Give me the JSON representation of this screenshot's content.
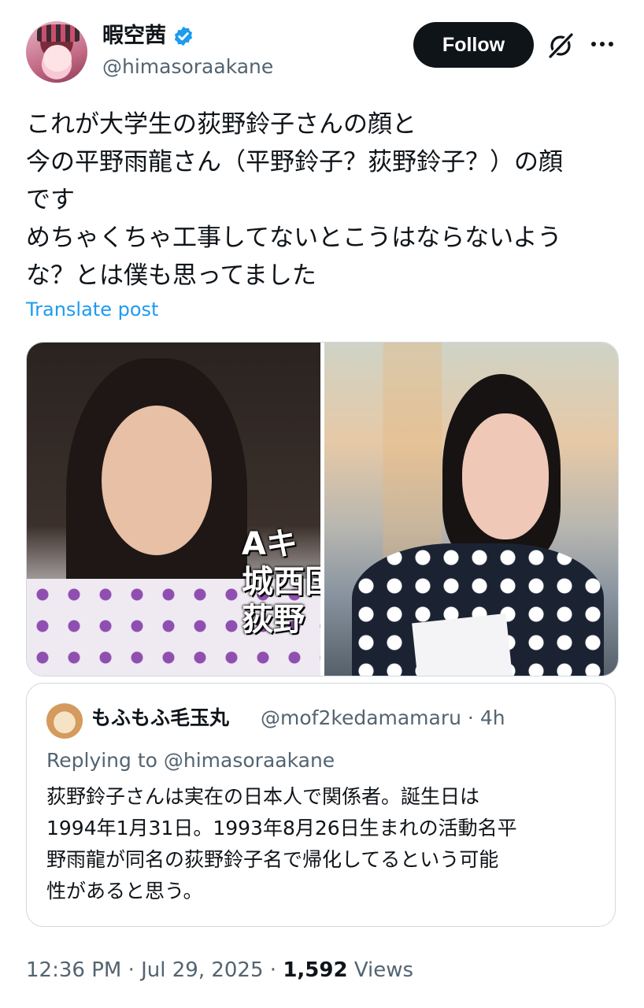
{
  "author": {
    "display_name": "暇空茜",
    "handle": "@himasoraakane",
    "verified_icon": "verified-badge-icon"
  },
  "actions": {
    "follow_label": "Follow",
    "grok_icon": "grok-icon",
    "more_icon": "more-icon"
  },
  "post": {
    "lines": [
      "これが大学生の荻野鈴子さんの顔と",
      "今の平野雨龍さん（平野鈴子？荻野鈴子？）の顔",
      "です",
      "めちゃくちゃ工事してないとこうはならないよう",
      "な？とは僕も思ってました"
    ],
    "translate_label": "Translate post"
  },
  "media": {
    "left_overlay_lines": [
      "Aキ",
      "城西国",
      "荻野"
    ]
  },
  "quote": {
    "name": "もふもふ毛玉丸",
    "meta": "@mof2kedamamaru · 4h",
    "replying_to": "Replying to @himasoraakane",
    "lines": [
      "荻野鈴子さんは実在の日本人で関係者。誕生日は",
      "1994年1月31日。1993年8月26日生まれの活動名平",
      "野雨龍が同名の荻野鈴子名で帰化してるという可能",
      "性があると思う。"
    ]
  },
  "footer": {
    "timestamp": "12:36 PM · Jul 29, 2025 · ",
    "views_count": "1,592",
    "views_label": " Views"
  },
  "colors": {
    "accent": "#1d9bf0",
    "text": "#0f1419",
    "muted": "#536471",
    "border": "#cfd9de"
  }
}
